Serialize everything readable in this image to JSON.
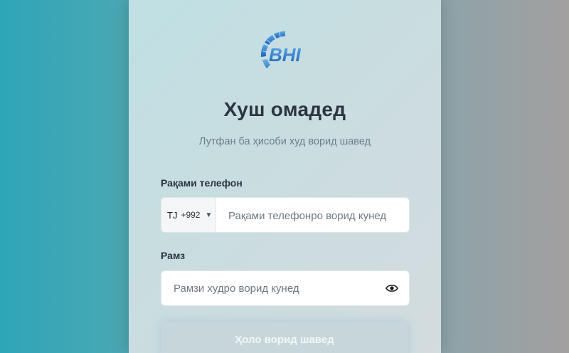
{
  "brand": {
    "logo_text": "BHI"
  },
  "header": {
    "title": "Хуш омадед",
    "subtitle": "Лутфан ба ҳисоби худ ворид шавед"
  },
  "form": {
    "phone_label": "Рақами телефон",
    "country_iso": "TJ",
    "country_code": "+992",
    "phone_value": "",
    "phone_placeholder": "Рақами телефонро ворид кунед",
    "password_label": "Рамз",
    "password_value": "",
    "password_placeholder": "Рамзи худро ворид кунед",
    "submit_label": "Ҳоло ворид шавед"
  },
  "icons": {
    "country_dropdown": "chevron-down-icon",
    "password_toggle": "eye-icon"
  },
  "colors": {
    "logo_blue": "#2b7fd1",
    "title": "#2c3440",
    "subtitle": "#6b7f8c",
    "button_disabled": "#c7d6da"
  }
}
